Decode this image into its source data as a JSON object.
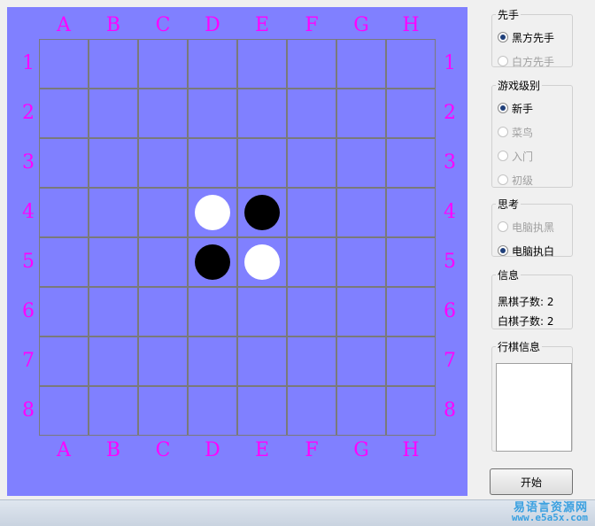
{
  "board": {
    "columns": [
      "A",
      "B",
      "C",
      "D",
      "E",
      "F",
      "G",
      "H"
    ],
    "rows": [
      "1",
      "2",
      "3",
      "4",
      "5",
      "6",
      "7",
      "8"
    ],
    "background_color": "#8080ff",
    "coord_color": "#ff00ff",
    "line_color": "#7a7a7a",
    "stones": [
      {
        "col": "D",
        "row": 4,
        "color": "white"
      },
      {
        "col": "E",
        "row": 4,
        "color": "black"
      },
      {
        "col": "D",
        "row": 5,
        "color": "black"
      },
      {
        "col": "E",
        "row": 5,
        "color": "white"
      }
    ]
  },
  "first_move": {
    "title": "先手",
    "options": [
      {
        "label": "黑方先手",
        "selected": true,
        "disabled": false
      },
      {
        "label": "白方先手",
        "selected": false,
        "disabled": true
      }
    ]
  },
  "level": {
    "title": "游戏级别",
    "options": [
      {
        "label": "新手",
        "selected": true,
        "disabled": false
      },
      {
        "label": "菜鸟",
        "selected": false,
        "disabled": true
      },
      {
        "label": "入门",
        "selected": false,
        "disabled": true
      },
      {
        "label": "初级",
        "selected": false,
        "disabled": true
      }
    ]
  },
  "thinking": {
    "title": "思考",
    "options": [
      {
        "label": "电脑执黑",
        "selected": false,
        "disabled": true
      },
      {
        "label": "电脑执白",
        "selected": true,
        "disabled": false
      }
    ]
  },
  "info": {
    "title": "信息",
    "black_count": "黑棋子数: 2",
    "white_count": "白棋子数: 2"
  },
  "move_info": {
    "title": "行棋信息"
  },
  "start_button": {
    "label": "开始"
  },
  "watermark": {
    "text": "易语言资源网",
    "url": "www.e5a5x.com"
  }
}
